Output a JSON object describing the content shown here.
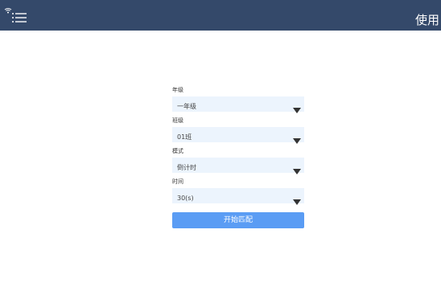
{
  "header": {
    "title": "使用",
    "menu_icon": "menu-icon",
    "status_icon": "wifi-icon",
    "background_color": "#34496a"
  },
  "form": {
    "fields": [
      {
        "label": "年级",
        "value": "一年级"
      },
      {
        "label": "班级",
        "value": "01班"
      },
      {
        "label": "模式",
        "value": "倒计时"
      },
      {
        "label": "时间",
        "value": "30(s)"
      }
    ],
    "select_background": "#ecf4fd",
    "dropdown_icon": "caret-down-icon"
  },
  "actions": {
    "start_label": "开始匹配",
    "start_color": "#5a9cf4"
  }
}
